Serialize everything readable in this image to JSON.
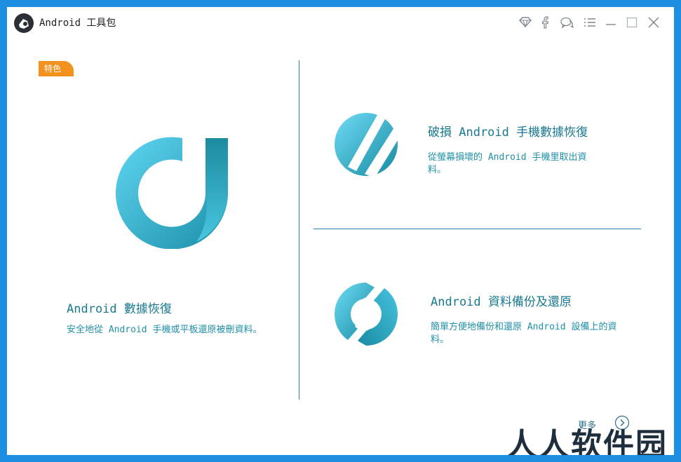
{
  "window": {
    "title": "Android 工具包"
  },
  "titlebar_buttons": [
    {
      "name": "diamond-icon"
    },
    {
      "name": "facebook-icon"
    },
    {
      "name": "chat-icon"
    },
    {
      "name": "menu-icon"
    },
    {
      "name": "minimize-icon"
    },
    {
      "name": "maximize-icon"
    },
    {
      "name": "close-icon"
    }
  ],
  "featured": {
    "badge": "特色",
    "title": "Android 數據恢復",
    "description": "安全地從 Android 手機或平板還原被刪資料。"
  },
  "cards": [
    {
      "title": "破損 Android 手機數據恢復",
      "description": "從螢幕損壞的 Android 手機里取出資料。"
    },
    {
      "title": "Android 資料備份及還原",
      "description": "簡單方便地備份和還原 Android 設備上的資料。"
    }
  ],
  "footer": {
    "more_label": "更多",
    "watermark": "人人软件园"
  },
  "colors": {
    "accent": "#19788f",
    "badge": "#f4921f",
    "divider": "#2b7fa6",
    "background": "#1e8fe0"
  }
}
